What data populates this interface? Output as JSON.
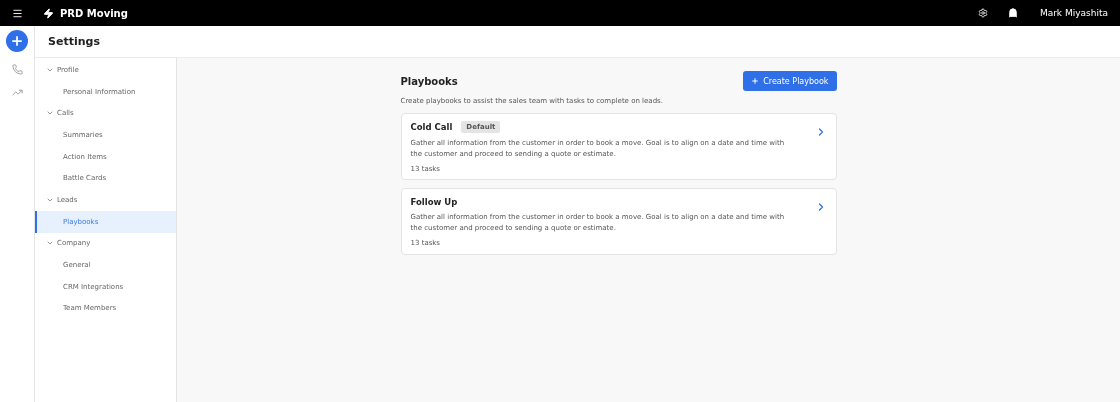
{
  "topbar": {
    "brand": "PRD Moving",
    "user": "Mark Miyashita"
  },
  "page": {
    "title": "Settings"
  },
  "nav": [
    {
      "label": "Profile",
      "expanded": true,
      "children": [
        {
          "label": "Personal Information",
          "selected": false
        }
      ]
    },
    {
      "label": "Calls",
      "expanded": true,
      "children": [
        {
          "label": "Summaries",
          "selected": false
        },
        {
          "label": "Action Items",
          "selected": false
        },
        {
          "label": "Battle Cards",
          "selected": false
        }
      ]
    },
    {
      "label": "Leads",
      "expanded": true,
      "children": [
        {
          "label": "Playbooks",
          "selected": true
        }
      ]
    },
    {
      "label": "Company",
      "expanded": true,
      "children": [
        {
          "label": "General",
          "selected": false
        },
        {
          "label": "CRM Integrations",
          "selected": false
        },
        {
          "label": "Team Members",
          "selected": false
        }
      ]
    }
  ],
  "content": {
    "title": "Playbooks",
    "create_button": "Create Playbook",
    "description": "Create playbooks to assist the sales team with tasks to complete on leads.",
    "playbooks": [
      {
        "name": "Cold Call",
        "badge": "Default",
        "description": "Gather all information from the customer in order to book a move. Goal is to align on a date and time with the customer and proceed to sending a quote or estimate.",
        "tasks": "13 tasks"
      },
      {
        "name": "Follow Up",
        "description": "Gather all information from the customer in order to book a move. Goal is to align on a date and time with the customer and proceed to sending a quote or estimate.",
        "tasks": "13 tasks"
      }
    ]
  }
}
